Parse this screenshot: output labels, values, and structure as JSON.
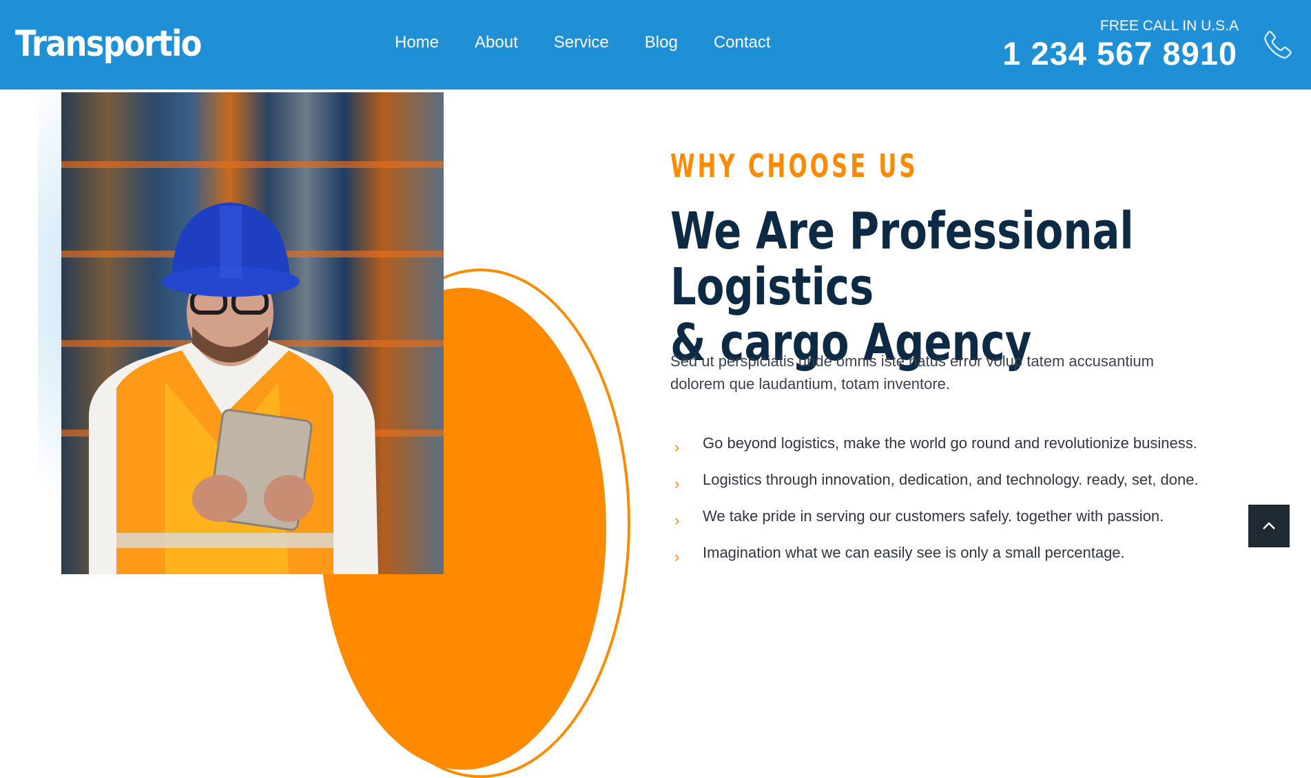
{
  "header": {
    "logo": "Transportio",
    "nav": [
      "Home",
      "About",
      "Service",
      "Blog",
      "Contact"
    ],
    "call_label": "FREE CALL IN U.S.A",
    "phone": "1 234 567 8910",
    "phone_icon": "phone-icon"
  },
  "section": {
    "eyebrow": "WHY CHOOSE US",
    "headline_line1": "We Are Professional Logistics",
    "headline_line2": "& cargo Agency",
    "description_line1": "Sed ut perspiciatis unde omnis iste natus error volup tatem accusantium",
    "description_line2": "dolorem que laudantium, totam inventore.",
    "features": [
      "Go beyond logistics, make the world go round and revolutionize business.",
      "Logistics through innovation, dedication, and technology. ready, set, done.",
      "We take pride in serving our customers safely. together with passion.",
      "Imagination what we can easily see is only a small percentage."
    ],
    "feature_icon": "chevron-right-icon",
    "feature_glyph": "›"
  },
  "colors": {
    "header_bg": "#1f8fd6",
    "accent": "#ff8a00",
    "headline": "#0c2a44",
    "to_top_bg": "#1f2a33"
  },
  "back_to_top_icon": "chevron-up-icon"
}
